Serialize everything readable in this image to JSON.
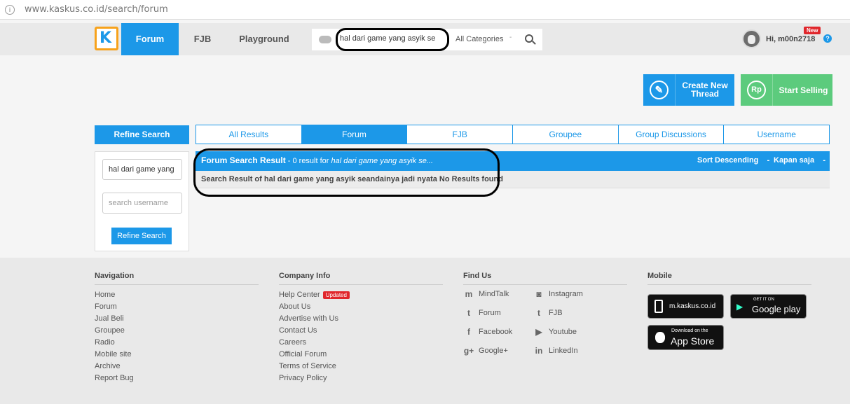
{
  "browser": {
    "url": "www.kaskus.co.id/search/forum",
    "info_icon": "i"
  },
  "nav": {
    "logo": "K",
    "tabs": [
      "Forum",
      "FJB",
      "Playground"
    ],
    "search_value": "hal dari game yang asyik se",
    "category": "All Categories",
    "caret": "-",
    "user_greeting": "Hi, m00n2718",
    "new_badge": "New",
    "help": "?"
  },
  "actions": {
    "create_icon": "✎",
    "create_label": "Create New Thread",
    "sell_icon": "Rp",
    "sell_label": "Start Selling"
  },
  "refine": {
    "header": "Refine Search",
    "keyword_value": "hal dari game yang",
    "username_placeholder": "search username",
    "button": "Refine Search"
  },
  "result_tabs": [
    "All Results",
    "Forum",
    "FJB",
    "Groupee",
    "Group Discussions",
    "Username"
  ],
  "result": {
    "title": "Forum Search Result",
    "count_text": " - 0 result for ",
    "query": "hal dari game yang asyik se...",
    "sort": "Sort Descending",
    "sort_caret": "-",
    "time": "Kapan saja",
    "time_caret": "-",
    "message": "Search Result of hal dari game yang asyik seandainya jadi nyata No Results found"
  },
  "footer": {
    "navigation": {
      "title": "Navigation",
      "items": [
        "Home",
        "Forum",
        "Jual Beli",
        "Groupee",
        "Radio",
        "Mobile site",
        "Archive",
        "Report Bug"
      ]
    },
    "company": {
      "title": "Company Info",
      "items": [
        "Help Center",
        "About Us",
        "Advertise with Us",
        "Contact Us",
        "Careers",
        "Official Forum",
        "Terms of Service",
        "Privacy Policy"
      ],
      "updated_badge": "Updated"
    },
    "findus": {
      "title": "Find Us",
      "left": [
        "MindTalk",
        "Forum",
        "Facebook",
        "Google+"
      ],
      "right": [
        "Instagram",
        "FJB",
        "Youtube",
        "LinkedIn"
      ]
    },
    "mobile": {
      "title": "Mobile",
      "msite": "m.kaskus.co.id",
      "gp_small": "GET IT ON",
      "gp_big": "Google play",
      "as_small": "Download on the",
      "as_big": "App Store"
    }
  }
}
